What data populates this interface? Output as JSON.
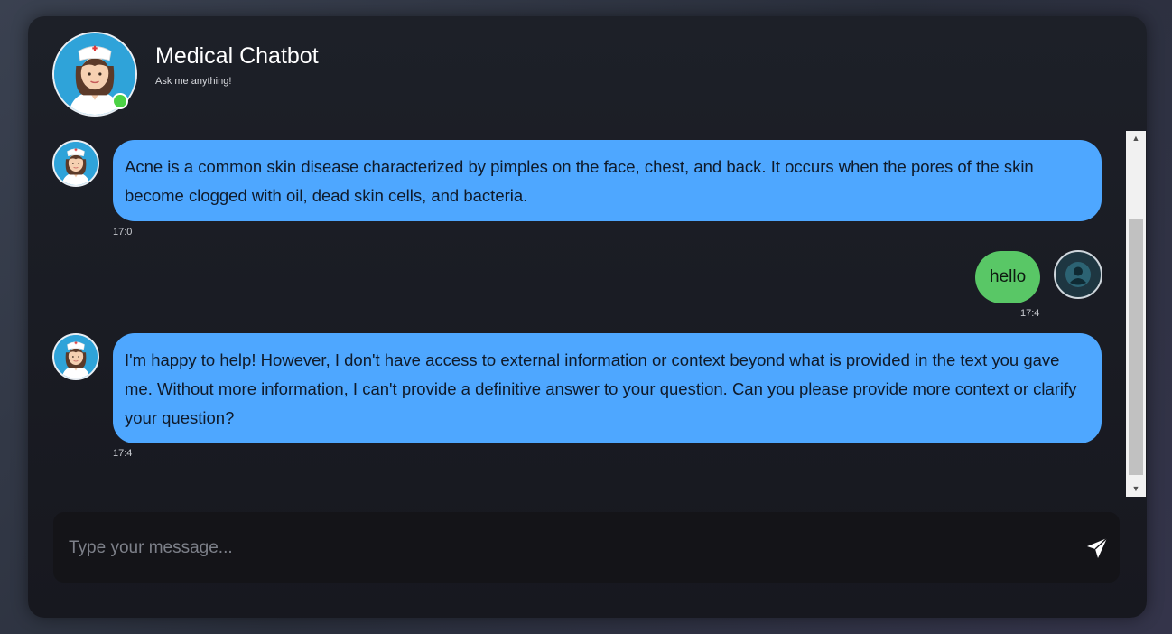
{
  "header": {
    "title": "Medical Chatbot",
    "subtitle": "Ask me anything!",
    "avatar_icon": "nurse-avatar-icon",
    "status_color": "#4cd245"
  },
  "messages": [
    {
      "sender": "bot",
      "text": "Acne is a common skin disease characterized by pimples on the face, chest, and back. It occurs when the pores of the skin become clogged with oil, dead skin cells, and bacteria.",
      "time": "17:0"
    },
    {
      "sender": "user",
      "text": "hello",
      "time": "17:4"
    },
    {
      "sender": "bot",
      "text": "I'm happy to help! However, I don't have access to external information or context beyond what is provided in the text you gave me. Without more information, I can't provide a definitive answer to your question. Can you please provide more context or clarify your question?",
      "time": "17:4"
    }
  ],
  "input": {
    "placeholder": "Type your message...",
    "value": "",
    "send_icon": "send-icon"
  },
  "colors": {
    "bot_bubble": "#4ea7ff",
    "user_bubble": "#59c766",
    "card_background": "#1b1d25"
  }
}
